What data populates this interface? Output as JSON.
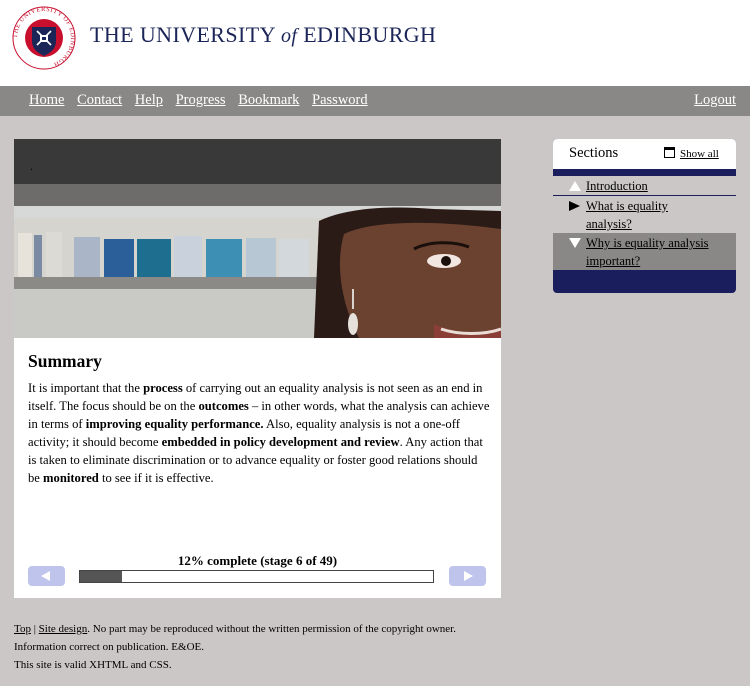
{
  "header": {
    "title_main": "THE UNIVERSITY ",
    "title_of": "of",
    "title_end": " EDINBURGH",
    "crest_text": "THE UNIVERSITY OF EDINBURGH"
  },
  "nav": {
    "home": "Home",
    "contact": "Contact",
    "help": "Help",
    "progress": "Progress",
    "bookmark": "Bookmark",
    "password": "Password",
    "logout": "Logout"
  },
  "hero": {
    "caption_dot": "."
  },
  "summary": {
    "title": "Summary",
    "p1": "It is important that the ",
    "b1": "process",
    "p2": " of carrying out an equality analysis is not seen as an end in itself. The focus should be on the ",
    "b2": "outcomes",
    "p3": " – in other words, what the analysis can achieve in terms of ",
    "b3": "improving equality performance.",
    "p4": " Also, equality analysis is not a one-off activity; it should become ",
    "b4": "embedded in policy development and review",
    "p5": ". Any action that is taken to eliminate discrimination or to advance equality or foster good relations should be ",
    "b5": "monitored",
    "p6": " to see if it is effective."
  },
  "progress": {
    "text": "12% complete (stage 6 of 49)",
    "fraction": 0.12
  },
  "sections": {
    "title": "Sections",
    "show_all": "Show all",
    "items": [
      {
        "label": "Introduction"
      },
      {
        "label": "What is equality analysis?"
      },
      {
        "label": "Why is equality analysis important?"
      }
    ]
  },
  "footer": {
    "top": "Top",
    "sep": " | ",
    "site_design": "Site design",
    "copyright": ". No part may be reproduced without the written permission of the copyright owner.",
    "line2": "Information correct on publication. E&OE.",
    "line3": "This site is valid XHTML and CSS."
  },
  "colors": {
    "brand_navy": "#1b2557",
    "crest_red": "#c8102e",
    "nav_grey": "#8a8887",
    "page_bg": "#cbc7c6",
    "button_lilac": "#bfc4ec"
  }
}
